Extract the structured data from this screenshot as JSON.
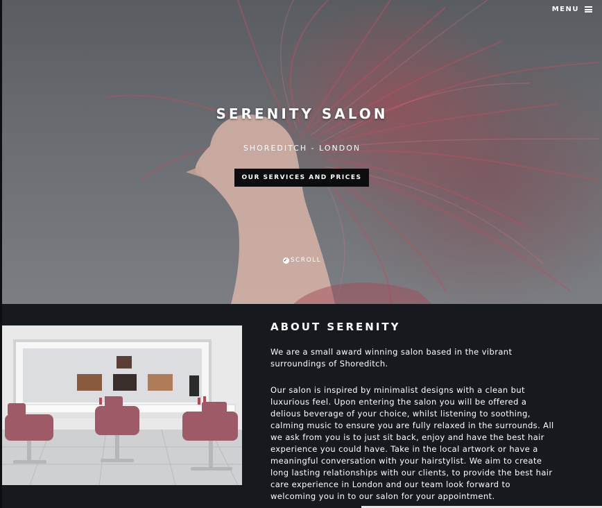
{
  "nav": {
    "menu_label": "MENU",
    "menu_icon": "hamburger-icon"
  },
  "hero": {
    "title": "SERENITY SALON",
    "subtitle": "SHOREDITCH - LONDON",
    "cta_label": "OUR SERVICES AND PRICES",
    "scroll_label": "SCROLL",
    "scroll_icon": "chevron-down-circle-icon"
  },
  "about": {
    "title": "ABOUT SERENITY",
    "paragraphs": [
      "We are a small award winning salon based in the vibrant surroundings of Shoreditch.",
      "Our salon is inspired by minimalist designs with a clean but luxurious feel. Upon entering the salon you will be offered a delious beverage of your choice, whilst listening to soothing, calming music to ensure you are fully relaxed in the surrounds. All we ask from you is to just sit back, enjoy and have the best hair experience you could have. Take in the local artwork or have a meaningful conversation with your hairstylist. We aim to create long lasting relationships with our clients, to provide the best hair care experience in London and our team look forward to welcoming you in to our salon for your appointment."
    ]
  },
  "colors": {
    "page_bg": "#16191d",
    "cta_bg": "#0b0c0e",
    "hair_red": "#b0505c",
    "chair_red": "#9e5a66"
  }
}
